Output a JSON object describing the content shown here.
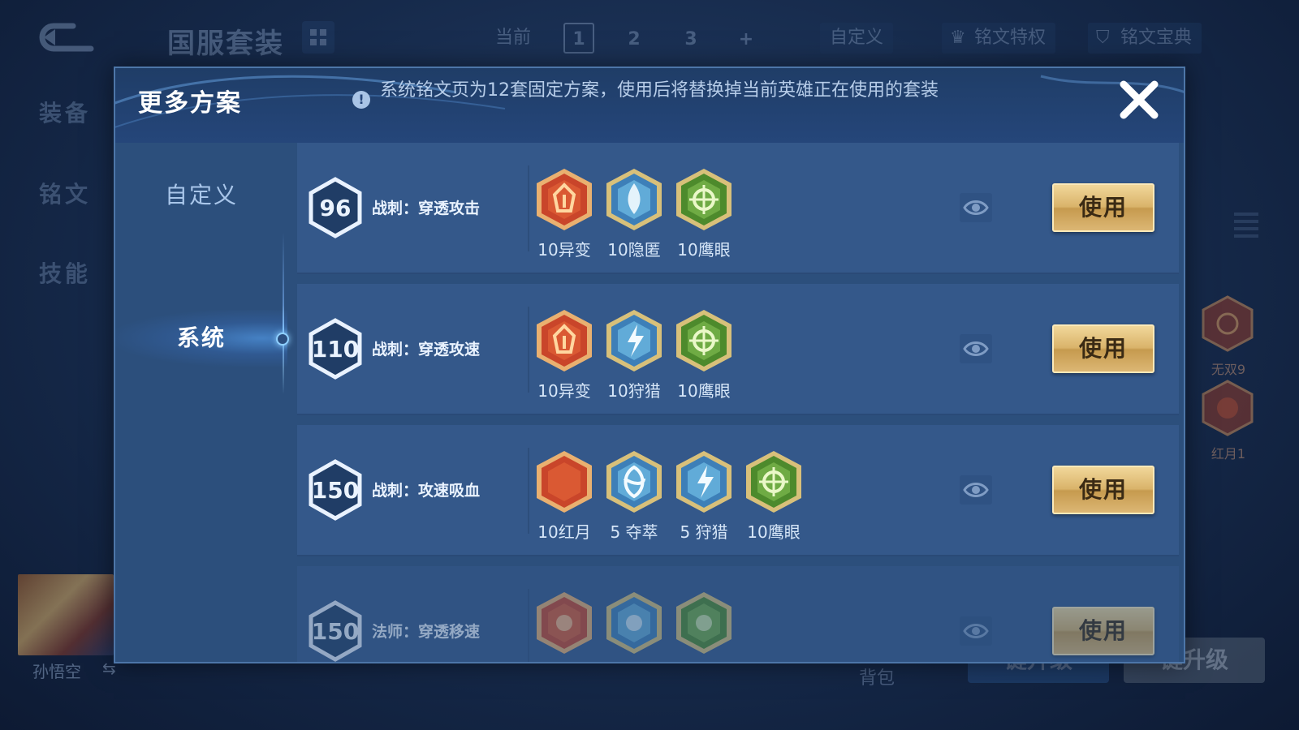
{
  "background": {
    "title": "国服套装",
    "top_tabs": {
      "current": "当前",
      "pages": [
        "1",
        "2",
        "3"
      ],
      "add": "+",
      "custom": "自定义",
      "privilege": "铭文特权",
      "codex": "铭文宝典"
    },
    "left_nav": [
      "装备",
      "铭文",
      "技能"
    ],
    "side_runes": [
      {
        "label": "无双9"
      },
      {
        "label": "红月1"
      }
    ],
    "hero_name": "孙悟空",
    "bag_label": "背包",
    "btn_upgrade_blue": "键升级",
    "btn_upgrade_gray": "键升级"
  },
  "modal": {
    "title": "更多方案",
    "info_text": "系统铭文页为12套固定方案，使用后将替换掉当前英雄正在使用的套装",
    "tabs": [
      {
        "label": "自定义",
        "active": false
      },
      {
        "label": "系统",
        "active": true
      }
    ],
    "schemes": [
      {
        "level": "96",
        "name": "战刺：穿透攻击",
        "runes": [
          {
            "icon": "red-mutation-rune-icon",
            "label": "10异变"
          },
          {
            "icon": "blue-stealth-rune-icon",
            "label": "10隐匿"
          },
          {
            "icon": "green-hawkeye-rune-icon",
            "label": "10鹰眼"
          }
        ],
        "use_label": "使用"
      },
      {
        "level": "110",
        "name": "战刺：穿透攻速",
        "runes": [
          {
            "icon": "red-mutation-rune-icon",
            "label": "10异变"
          },
          {
            "icon": "blue-hunt-rune-icon",
            "label": "10狩猎"
          },
          {
            "icon": "green-hawkeye-rune-icon",
            "label": "10鹰眼"
          }
        ],
        "use_label": "使用"
      },
      {
        "level": "150",
        "name": "战刺：攻速吸血",
        "runes": [
          {
            "icon": "red-redmoon-rune-icon",
            "label": "10红月"
          },
          {
            "icon": "blue-plunder-rune-icon",
            "label": "5 夺萃"
          },
          {
            "icon": "blue-hunt-rune-icon",
            "label": "5 狩猎"
          },
          {
            "icon": "green-hawkeye-rune-icon",
            "label": "10鹰眼"
          }
        ],
        "use_label": "使用"
      },
      {
        "level": "150",
        "name": "法师：穿透移速",
        "runes": [
          {
            "icon": "red-rune-icon",
            "label": ""
          },
          {
            "icon": "blue-rune-icon",
            "label": ""
          },
          {
            "icon": "green-rune-icon",
            "label": ""
          }
        ],
        "use_label": "使用"
      }
    ]
  },
  "colors": {
    "modal_bg": "#2c4f7c",
    "row_bg": "#34588a",
    "use_button_gold": "#d9b36a",
    "rune_red": "#d9532b",
    "rune_blue": "#6cc1ea",
    "rune_green": "#79b649"
  }
}
